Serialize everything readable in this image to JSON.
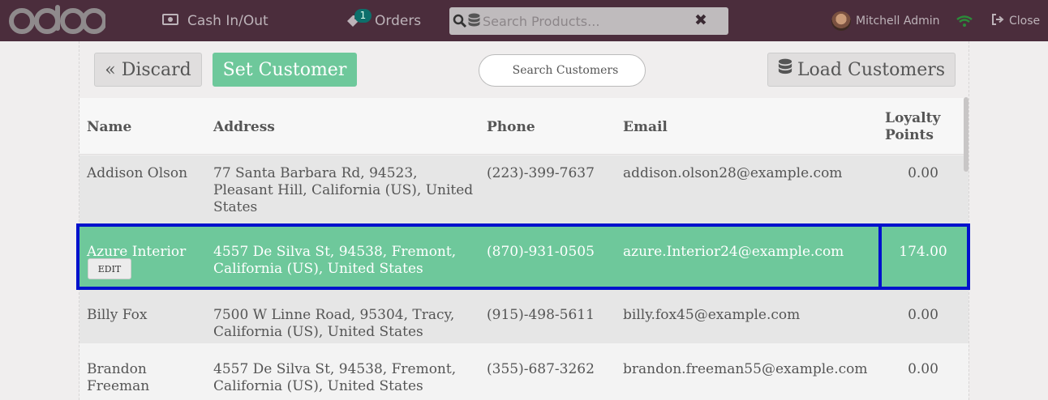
{
  "header": {
    "logo_text": "odoo",
    "cash_label": "Cash In/Out",
    "orders_count": "1",
    "orders_label": "Orders",
    "search_placeholder": "Search Products...",
    "user_name": "Mitchell Admin",
    "close_label": "Close"
  },
  "toolbar": {
    "discard_label": "« Discard",
    "set_customer_label": "Set Customer",
    "search_customers_placeholder": "Search Customers",
    "load_customers_label": "Load Customers"
  },
  "table": {
    "columns": [
      "Name",
      "Address",
      "Phone",
      "Email",
      "Loyalty Points"
    ],
    "rows": [
      {
        "name": "Addison Olson",
        "address": "77 Santa Barbara Rd, 94523, Pleasant Hill, California (US), United States",
        "phone": "(223)-399-7637",
        "email": "addison.olson28@example.com",
        "points": "0.00"
      },
      {
        "name": "Azure Interior",
        "address": "4557 De Silva St, 94538, Fremont, California (US), United States",
        "phone": "(870)-931-0505",
        "email": "azure.Interior24@example.com",
        "points": "174.00",
        "selected": true,
        "edit_label": "EDIT"
      },
      {
        "name": "Billy Fox",
        "address": "7500 W Linne Road, 95304, Tracy, California (US), United States",
        "phone": "(915)-498-5611",
        "email": "billy.fox45@example.com",
        "points": "0.00"
      },
      {
        "name": "Brandon Freeman",
        "address": "4557 De Silva St, 94538, Fremont, California (US), United States",
        "phone": "(355)-687-3262",
        "email": "brandon.freeman55@example.com",
        "points": "0.00"
      }
    ]
  },
  "colors": {
    "topbar": "#4b2d3c",
    "accent_green": "#6ec89b",
    "selection_outline": "#0011cc"
  },
  "icons": [
    "money-icon",
    "tag-icon",
    "search-icon",
    "database-icon",
    "clear-icon",
    "wifi-icon",
    "sign-out-icon"
  ]
}
